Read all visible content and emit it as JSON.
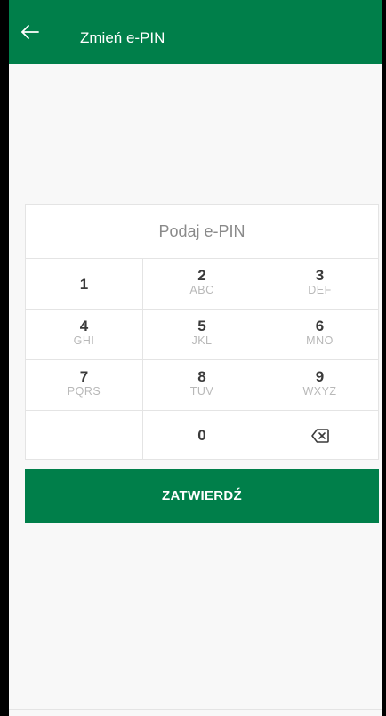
{
  "header": {
    "title": "Zmień e-PIN",
    "back_icon": "arrow-left-icon"
  },
  "pin_input": {
    "placeholder": "Podaj e-PIN",
    "value": ""
  },
  "keypad": {
    "keys": [
      {
        "digit": "1",
        "letters": ""
      },
      {
        "digit": "2",
        "letters": "ABC"
      },
      {
        "digit": "3",
        "letters": "DEF"
      },
      {
        "digit": "4",
        "letters": "GHI"
      },
      {
        "digit": "5",
        "letters": "JKL"
      },
      {
        "digit": "6",
        "letters": "MNO"
      },
      {
        "digit": "7",
        "letters": "PQRS"
      },
      {
        "digit": "8",
        "letters": "TUV"
      },
      {
        "digit": "9",
        "letters": "WXYZ"
      },
      {
        "digit": "0",
        "letters": ""
      }
    ],
    "backspace_icon": "backspace-icon"
  },
  "confirm_button": {
    "label": "ZATWIERDŹ"
  },
  "colors": {
    "brand_green": "#007f4a",
    "background": "#f8f8f8",
    "card": "#ffffff",
    "divider": "#e4e4e4",
    "placeholder_text": "#8a8a8a",
    "digit_text": "#3a3a3a",
    "letters_text": "#b8b8b8"
  }
}
